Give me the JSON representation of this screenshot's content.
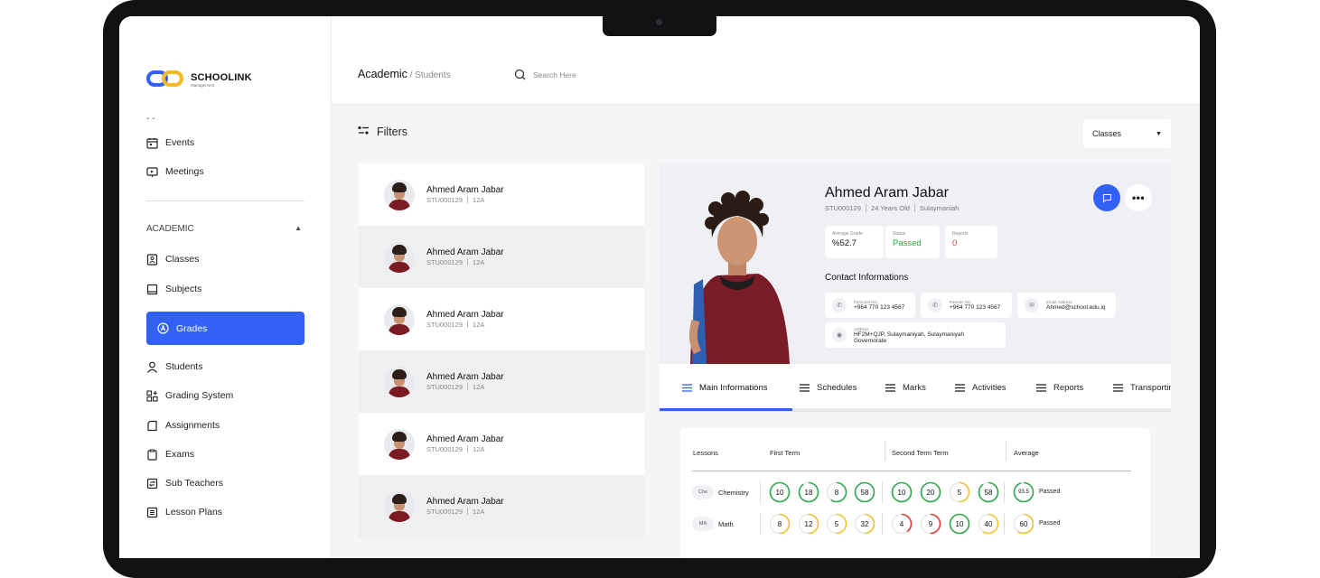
{
  "app": {
    "name": "SCHOOLINK",
    "tagline": "Management"
  },
  "sidebar": {
    "collapsed_marker": "- -",
    "items_top": [
      {
        "label": "Events",
        "icon": "calendar-icon"
      },
      {
        "label": "Meetings",
        "icon": "presentation-icon"
      }
    ],
    "section": {
      "label": "ACADEMIC",
      "icon": "caret-up-icon"
    },
    "items": [
      {
        "label": "Classes",
        "icon": "id-card-icon"
      },
      {
        "label": "Subjects",
        "icon": "book-icon"
      },
      {
        "label": "Grades",
        "icon": "grade-icon",
        "active": true
      },
      {
        "label": "Students",
        "icon": "user-icon"
      },
      {
        "label": "Grading System",
        "icon": "grid-icon"
      },
      {
        "label": "Assignments",
        "icon": "document-icon"
      },
      {
        "label": "Exams",
        "icon": "clipboard-icon"
      },
      {
        "label": "Sub Teachers",
        "icon": "swap-icon"
      },
      {
        "label": "Lesson Plans",
        "icon": "list-icon"
      }
    ]
  },
  "header": {
    "breadcrumb_main": "Academic",
    "breadcrumb_sub": " / Students",
    "search_placeholder": "Search Here"
  },
  "filters": {
    "label": "Filters",
    "classes_select": "Classes"
  },
  "students": [
    {
      "name": "Ahmed Aram Jabar",
      "id": "STU000129",
      "class": "12A"
    },
    {
      "name": "Ahmed Aram Jabar",
      "id": "STU000129",
      "class": "12A"
    },
    {
      "name": "Ahmed Aram Jabar",
      "id": "STU000129",
      "class": "12A"
    },
    {
      "name": "Ahmed Aram Jabar",
      "id": "STU000129",
      "class": "12A"
    },
    {
      "name": "Ahmed Aram Jabar",
      "id": "STU000129",
      "class": "12A"
    },
    {
      "name": "Ahmed Aram Jabar",
      "id": "STU000129",
      "class": "12A"
    }
  ],
  "profile": {
    "name": "Ahmed Aram Jabar",
    "id": "STU000129",
    "age": "24 Years Old",
    "city": "Sulaymaniah",
    "stats": [
      {
        "label": "Average Grade",
        "value": "%52.7",
        "color": "#111111"
      },
      {
        "label": "Status",
        "value": "Passed",
        "color": "#1faa3b"
      },
      {
        "label": "Reports",
        "value": "0",
        "color": "#e53935"
      }
    ],
    "contact_title": "Contact Informations",
    "contacts": [
      {
        "label": "Personal NO.",
        "value": "+964 770 123 4567",
        "icon": "phone-icon"
      },
      {
        "label": "Parents NO.",
        "value": "+964 770 123 4567",
        "icon": "phone-icon"
      },
      {
        "label": "Email Address",
        "value": "Ahmed@school.edu.iq",
        "icon": "mail-icon"
      },
      {
        "label": "Address",
        "value": "HF2M+QJP, Sulaymaniyah, Sulaymaniyah Governorate",
        "icon": "location-icon"
      }
    ]
  },
  "tabs": [
    "Main Informations",
    "Schedules",
    "Marks",
    "Activities",
    "Reports",
    "Transportin"
  ],
  "marks": {
    "headers": {
      "lessons": "Lessons",
      "first": "First Term",
      "second": "Second Term Term",
      "average": "Average"
    },
    "rows": [
      {
        "abbr": "Che",
        "lesson": "Chemistry",
        "first": [
          {
            "v": "10",
            "frac": 1.0,
            "color": "#2ea84a"
          },
          {
            "v": "18",
            "frac": 0.9,
            "color": "#2ea84a"
          },
          {
            "v": "8",
            "frac": 0.6,
            "color": "#2ea84a"
          },
          {
            "v": "58",
            "frac": 1.0,
            "color": "#2ea84a"
          }
        ],
        "second": [
          {
            "v": "10",
            "frac": 1.0,
            "color": "#2ea84a"
          },
          {
            "v": "20",
            "frac": 1.0,
            "color": "#2ea84a"
          },
          {
            "v": "5",
            "frac": 0.5,
            "color": "#f2c230"
          },
          {
            "v": "58",
            "frac": 0.9,
            "color": "#2ea84a"
          }
        ],
        "avg": {
          "v": "93.5",
          "frac": 0.95,
          "color": "#2ea84a"
        },
        "status": "Passed"
      },
      {
        "abbr": "MA",
        "lesson": "Math",
        "first": [
          {
            "v": "8",
            "frac": 0.5,
            "color": "#f2c230"
          },
          {
            "v": "12",
            "frac": 0.5,
            "color": "#f2c230"
          },
          {
            "v": "5",
            "frac": 0.5,
            "color": "#f2c230"
          },
          {
            "v": "32",
            "frac": 0.5,
            "color": "#f2c230"
          }
        ],
        "second": [
          {
            "v": "4",
            "frac": 0.4,
            "color": "#e53935"
          },
          {
            "v": "9",
            "frac": 0.5,
            "color": "#e53935"
          },
          {
            "v": "10",
            "frac": 1.0,
            "color": "#2ea84a"
          },
          {
            "v": "40",
            "frac": 0.6,
            "color": "#f2c230"
          }
        ],
        "avg": {
          "v": "60",
          "frac": 0.6,
          "color": "#f2c230"
        },
        "status": "Passed"
      }
    ]
  },
  "colors": {
    "accent": "#3161f5",
    "green": "#2ea84a",
    "yellow": "#f2c230",
    "red": "#e53935"
  }
}
